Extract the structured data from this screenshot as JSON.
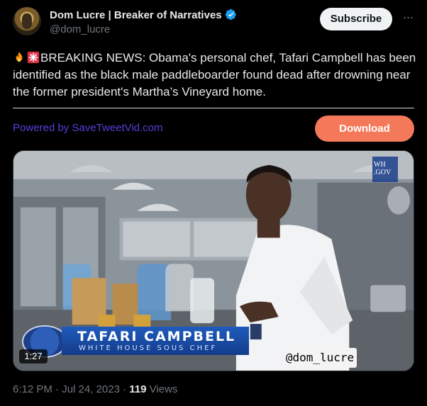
{
  "author": {
    "display_name": "Dom Lucre | Breaker of Narratives",
    "handle": "@dom_lucre",
    "verified": true,
    "avatar_icon": "avatar-image"
  },
  "actions": {
    "subscribe_label": "Subscribe",
    "more_icon": "more-icon",
    "more_glyph": "···"
  },
  "tweet": {
    "emojis": [
      "fire-emoji",
      "siren-emoji"
    ],
    "text": "BREAKING NEWS: Obama's personal chef, Tafari Campbell has been identified as the black male paddleboarder found dead after drowning near the former president's Martha’s Vineyard home."
  },
  "promo": {
    "powered_by": "Powered by SaveTweetVid.com",
    "download_label": "Download"
  },
  "video": {
    "lower_third_name": "TAFARI CAMPBELL",
    "lower_third_title": "WHITE HOUSE SOUS CHEF",
    "corner_logo_top": "WH",
    "corner_logo_bottom": ".GOV",
    "watermark": "@dom_lucre",
    "duration": "1:27"
  },
  "footer": {
    "time": "6:12 PM",
    "date": "Jul 24, 2023",
    "separator": "·",
    "views_count": "119",
    "views_label": "Views"
  },
  "colors": {
    "background": "#000000",
    "subscribe_bg": "#eff3f4",
    "download_bg": "#f4795a",
    "powered_by": "#5c3bd9",
    "verified": "#1d9bf0",
    "muted": "#71767b"
  }
}
